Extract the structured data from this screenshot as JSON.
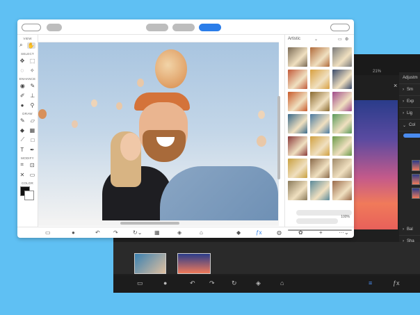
{
  "dark_window": {
    "zoom_label": "21%",
    "panel_title": "Adjustm",
    "panel_rows": [
      "Sm",
      "Exp",
      "Lig",
      "Col",
      "Bal",
      "Sha"
    ],
    "close_glyph": "×"
  },
  "front_window": {
    "tool_sections": [
      "VIEW",
      "SELECT",
      "ENHANCE",
      "DRAW",
      "MODIFY",
      "COLOR"
    ],
    "right_panel_title": "Artistic",
    "percent_label": "100%",
    "thumb_colors": [
      "#7a6a55",
      "#b06a3a",
      "#7a7a7a",
      "#c25a3a",
      "#d8a040",
      "#3a4a6a",
      "#c85a2a",
      "#8a6a30",
      "#a04a8a",
      "#3a6a8a",
      "#4a7aa0",
      "#5a9a5a",
      "#8a3a3a",
      "#d0a040",
      "#6a9a4a",
      "#c8a040",
      "#8a6a4a",
      "#a08a6a",
      "#8a7a5a",
      "#5a8a9a",
      "#9a6a4a"
    ]
  },
  "colors": {
    "background": "#5fc0f3",
    "accent": "#2b7de9"
  }
}
